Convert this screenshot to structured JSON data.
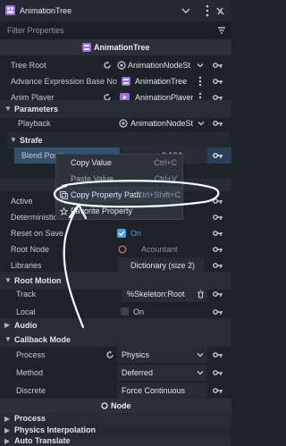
{
  "header": {
    "node_name": "AnimationTree",
    "filter_placeholder": "Filter Properties"
  },
  "class_title": "AnimationTree",
  "props": {
    "tree_root": {
      "label": "Tree Root",
      "value": "AnimationNodeSt"
    },
    "adv_expr": {
      "label": "Advance Expression Base No",
      "value": "AnimationTree"
    },
    "anim_player": {
      "label": "Anim Player",
      "value": "AnimationPlayer"
    }
  },
  "parameters": {
    "title": "Parameters",
    "playback": {
      "label": "Playback",
      "value": "AnimationNodeSt"
    },
    "strafe": "Strafe",
    "blend_position": {
      "label": "Blend Position",
      "x": "x",
      "value": "-0.104"
    }
  },
  "context_menu": {
    "items": [
      {
        "label": "Copy Value",
        "shortcut": "Ctrl+C"
      },
      {
        "label": "Paste Value",
        "shortcut": "Ctrl+V"
      },
      {
        "label": "Copy Property Path",
        "shortcut": "Ctrl+Shift+C"
      },
      {
        "label": "Favorite Property",
        "shortcut": ""
      }
    ]
  },
  "props2": {
    "active": {
      "label": "Active"
    },
    "deterministic": {
      "label": "Deterministic"
    },
    "reset_on_save": {
      "label": "Reset on Save",
      "value": "On"
    },
    "root_node": {
      "label": "Root Node",
      "value": "Acountant"
    },
    "libraries": {
      "label": "Libraries",
      "value": "Dictionary (size 2)"
    }
  },
  "root_motion": {
    "title": "Root Motion",
    "track": {
      "label": "Track",
      "value": "%Skeleton:Root"
    },
    "local": {
      "label": "Local",
      "value": "On"
    }
  },
  "audio": {
    "title": "Audio"
  },
  "callback": {
    "title": "Callback Mode",
    "process": {
      "label": "Process",
      "value": "Physics"
    },
    "method": {
      "label": "Method",
      "value": "Deferred"
    },
    "discrete": {
      "label": "Discrete",
      "value": "Force Continuous"
    }
  },
  "node_title": "Node",
  "node_sections": [
    "Process",
    "Physics Interpolation",
    "Auto Translate"
  ],
  "colors": {
    "accent": "#4aa0f0",
    "checkbox_on": "#4a9de8",
    "node_icon": "#b77ef0",
    "annotation": "#ffffff"
  }
}
